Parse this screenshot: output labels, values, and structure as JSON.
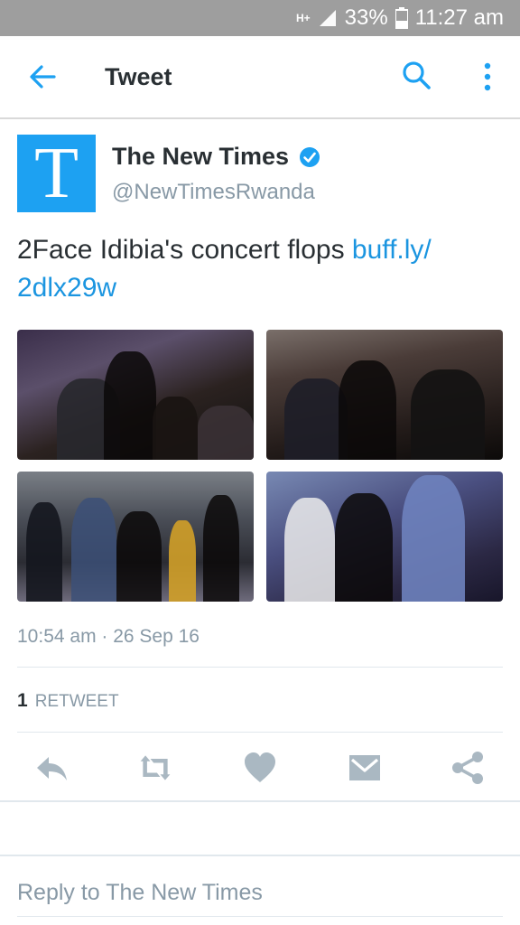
{
  "status_bar": {
    "network": "H+",
    "battery": "33%",
    "time": "11:27 am"
  },
  "app_bar": {
    "title": "Tweet",
    "icons": [
      "back-arrow-icon",
      "search-icon",
      "more-vert-icon"
    ]
  },
  "tweet": {
    "avatar_letter": "T",
    "author_name": "The New Times",
    "author_handle": "@NewTimesRwanda",
    "verified": true,
    "text": "2Face Idibia's concert flops ",
    "link": "buff.ly/\n2dlx29w",
    "photos": [
      "concert-photo-1",
      "concert-photo-2",
      "concert-photo-3",
      "concert-photo-4"
    ],
    "timestamp": "10:54 am · 26 Sep 16",
    "retweet_count": "1",
    "retweet_label": "RETWEET"
  },
  "actions": {
    "icons": [
      "reply-icon",
      "retweet-icon",
      "like-icon",
      "message-icon",
      "share-icon"
    ]
  },
  "reply": {
    "placeholder": "Reply to The New Times"
  },
  "colors": {
    "accent": "#1da1f2",
    "link": "#1b95e0",
    "muted": "#8899a6",
    "action_icon": "#aab8c2",
    "status_bar": "#9e9e9e"
  }
}
